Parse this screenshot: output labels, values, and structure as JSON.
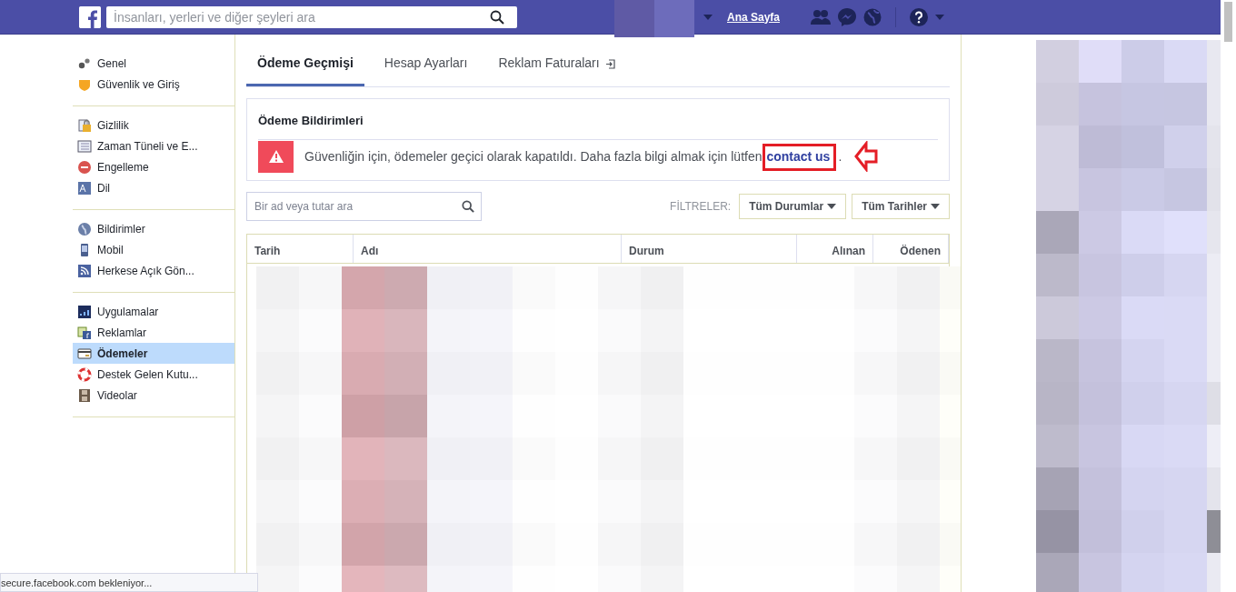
{
  "navbar": {
    "search": {
      "placeholder": "İnsanları, yerleri ve diğer şeyleri ara"
    },
    "home": "Ana Sayfa"
  },
  "sidebar": {
    "groups": [
      {
        "items": [
          {
            "label": "Genel",
            "selected": false
          },
          {
            "label": "Güvenlik ve Giriş",
            "selected": false
          }
        ]
      },
      {
        "items": [
          {
            "label": "Gizlilik",
            "selected": false
          },
          {
            "label": "Zaman Tüneli ve E...",
            "selected": false
          },
          {
            "label": "Engelleme",
            "selected": false
          },
          {
            "label": "Dil",
            "selected": false
          }
        ]
      },
      {
        "items": [
          {
            "label": "Bildirimler",
            "selected": false
          },
          {
            "label": "Mobil",
            "selected": false
          },
          {
            "label": "Herkese Açık Gön...",
            "selected": false
          }
        ]
      },
      {
        "items": [
          {
            "label": "Uygulamalar",
            "selected": false
          },
          {
            "label": "Reklamlar",
            "selected": false
          },
          {
            "label": "Ödemeler",
            "selected": true
          },
          {
            "label": "Destek Gelen Kutu...",
            "selected": false
          },
          {
            "label": "Videolar",
            "selected": false
          }
        ]
      }
    ]
  },
  "tabs": [
    {
      "label": "Ödeme Geçmişi",
      "selected": true,
      "external": false
    },
    {
      "label": "Hesap Ayarları",
      "selected": false,
      "external": false
    },
    {
      "label": "Reklam Faturaları",
      "selected": false,
      "external": true
    }
  ],
  "notice": {
    "title": "Ödeme Bildirimleri",
    "message": "Güvenliğin için, ödemeler geçici olarak kapatıldı. Daha fazla bilgi almak için lütfen",
    "link": {
      "text": "contact us",
      "highlighted": true
    },
    "end": "."
  },
  "search": {
    "placeholder": "Bir ad veya tutar ara"
  },
  "filters": {
    "label": "FİLTRELER:",
    "dropdowns": [
      "Tüm Durumlar",
      "Tüm Tarihler"
    ]
  },
  "table": {
    "columns": [
      "Tarih",
      "Adı",
      "Durum",
      "Alınan",
      "Ödenen"
    ]
  },
  "status_bar": "secure.facebook.com bekleniyor..."
}
